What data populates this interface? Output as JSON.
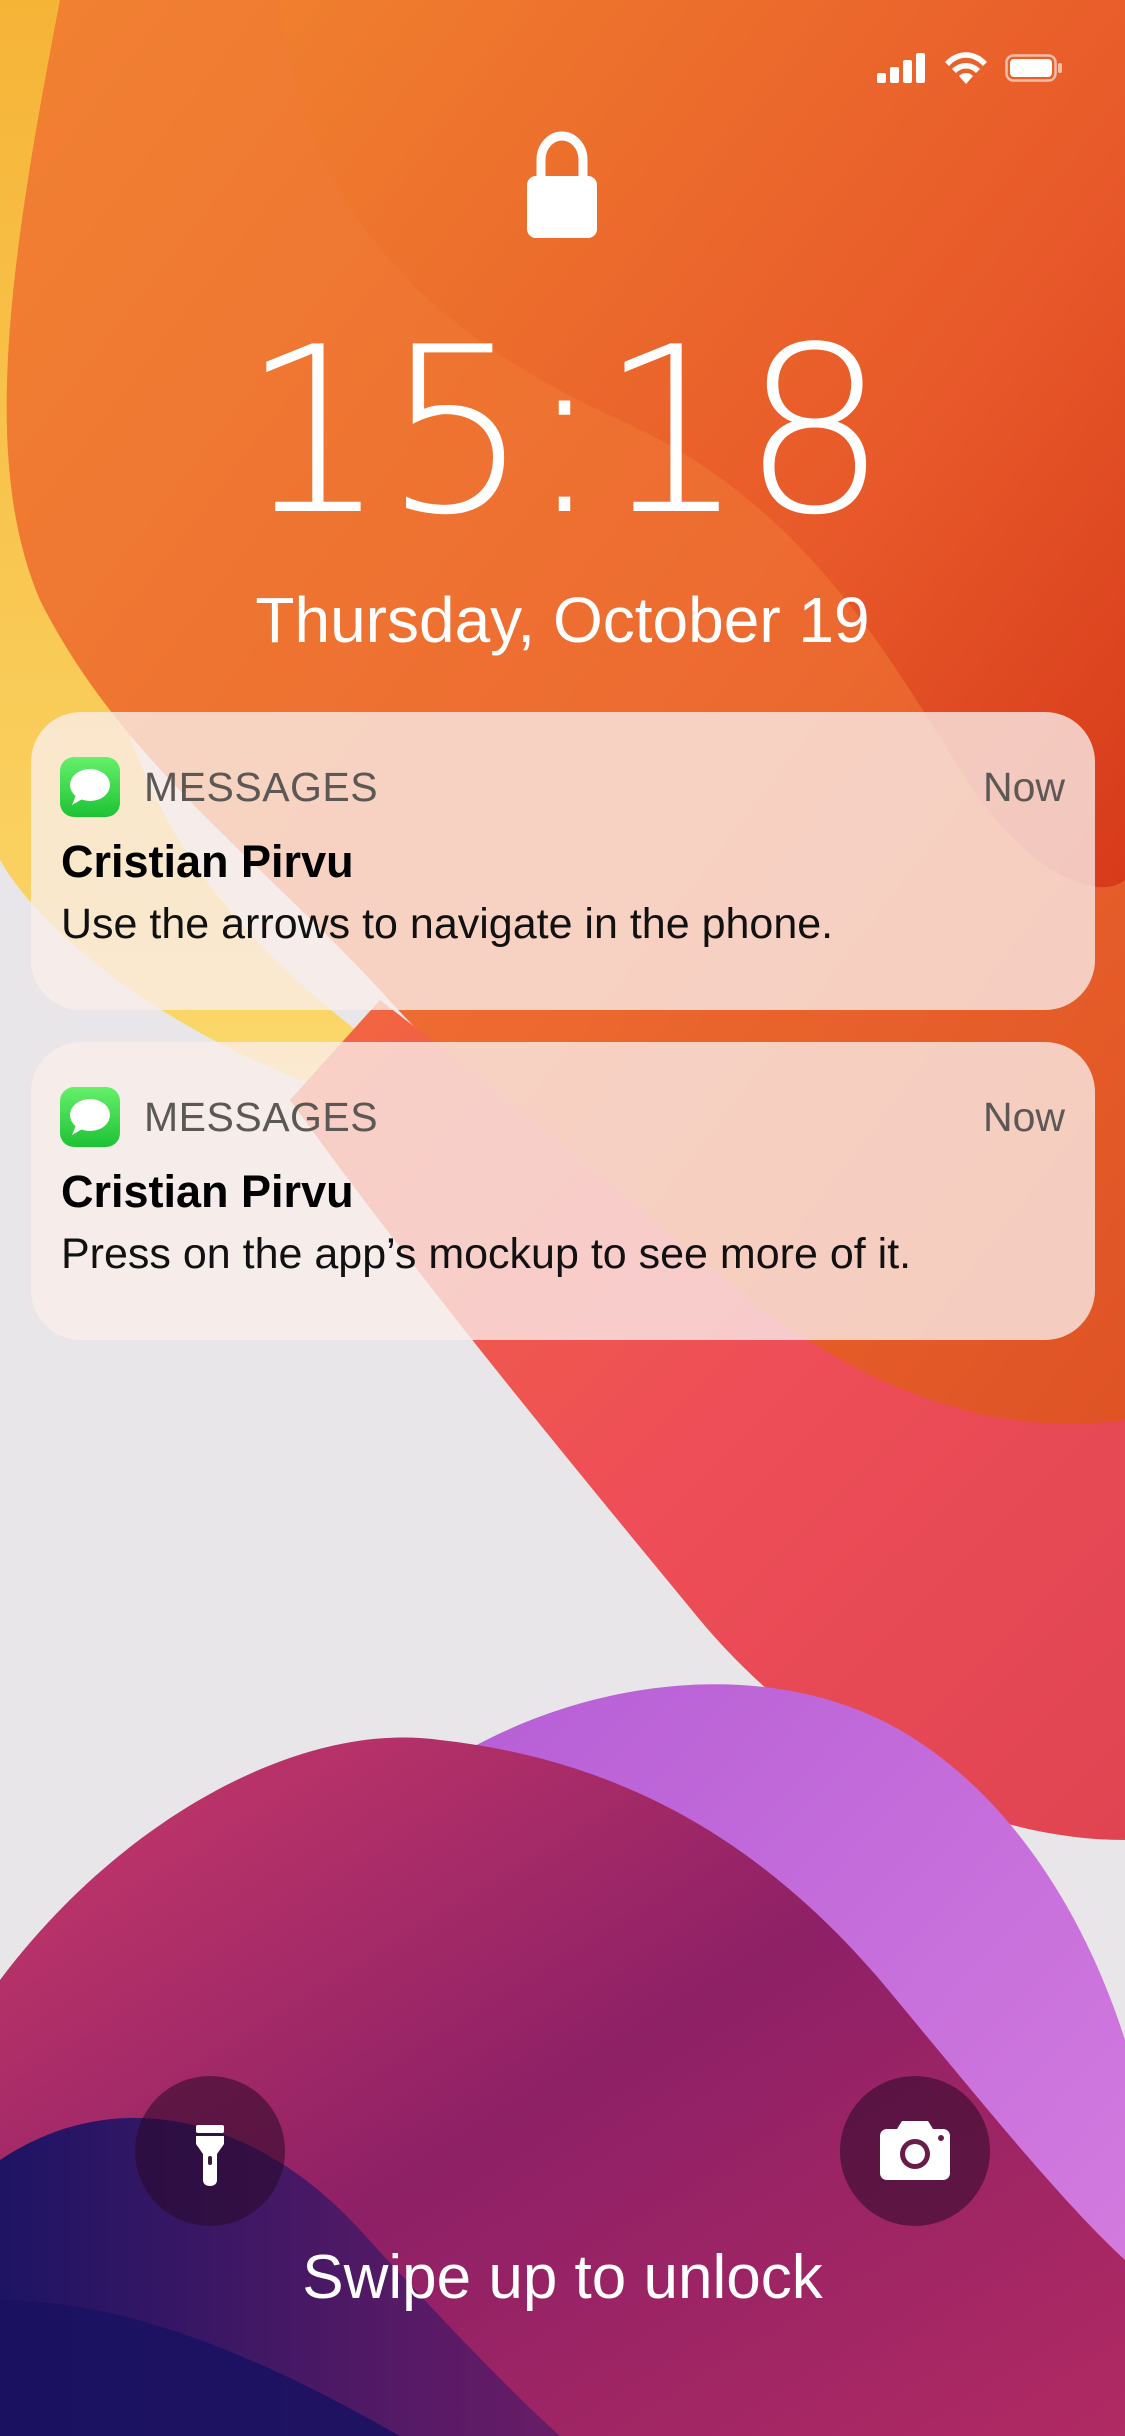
{
  "status_bar": {
    "signal_icon": "cellular-signal-icon",
    "wifi_icon": "wifi-icon",
    "battery_icon": "battery-icon",
    "battery_level": 1.0
  },
  "lock_screen": {
    "lock_icon": "lock-icon",
    "time": "15:18",
    "date": "Thursday, October 19"
  },
  "notifications": [
    {
      "app_icon": "messages-app-icon",
      "app_name": "MESSAGES",
      "time": "Now",
      "sender": "Cristian Pirvu",
      "body": "Use the arrows to navigate in the phone."
    },
    {
      "app_icon": "messages-app-icon",
      "app_name": "MESSAGES",
      "time": "Now",
      "sender": "Cristian Pirvu",
      "body": "Press on the app’s mockup to see more of it."
    }
  ],
  "quick_actions": {
    "flashlight_icon": "flashlight-icon",
    "camera_icon": "camera-icon"
  },
  "swipe_hint": "Swipe up to unlock",
  "colors": {
    "notification_bg": "#faeeec",
    "messages_green": "#2ecf45",
    "text_white": "#ffffff"
  }
}
